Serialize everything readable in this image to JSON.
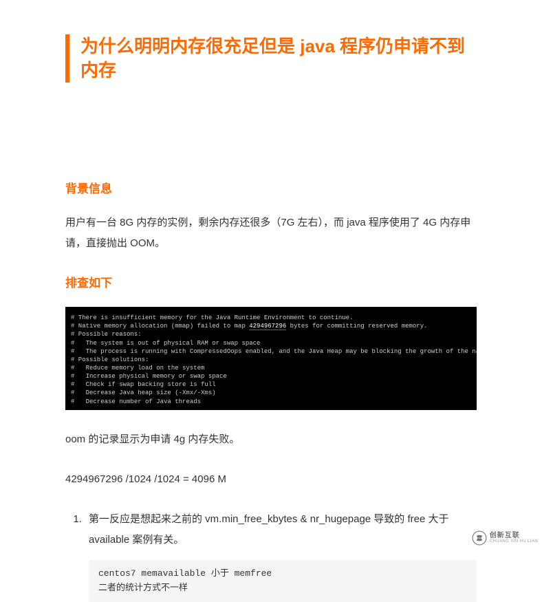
{
  "title": "为什么明明内存很充足但是 java 程序仍申请不到内存",
  "sections": {
    "bg_heading": "背景信息",
    "bg_para": "用户有一台 8G 内存的实例，剩余内存还很多（7G 左右），而 java 程序使用了 4G 内存申请，直接抛出 OOM。",
    "inv_heading": "排查如下",
    "oom_note": "oom 的记录显示为申请 4g 内存失败。",
    "calc_line": "4294967296 /1024 /1024 = 4096 M",
    "step1": "第一反应是想起来之前的 vm.min_free_kbytes & nr_hugepage 导致的 free 大于 available 案例有关。",
    "code_line1": "centos7 memavailable 小于 memfree",
    "code_line2": "二者的统计方式不一样"
  },
  "terminal": {
    "l1a": "# There is insufficient memory for the Java Runtime Environment to continue.",
    "l2a": "# Native memory allocation (mmap) failed to map ",
    "l2b": "4294967296",
    "l2c": " bytes for committing reserved memory.",
    "l3": "# Possible reasons:",
    "l4": "#   The system is out of physical RAM or swap space",
    "l5": "#   The process is running with CompressedOops enabled, and the Java Heap may be blocking the growth of the native heap",
    "l6": "# Possible solutions:",
    "l7": "#   Reduce memory load on the system",
    "l8": "#   Increase physical memory or swap space",
    "l9": "#   Check if swap backing store is full",
    "l10": "#   Decrease Java heap size (-Xmx/-Xms)",
    "l11": "#   Decrease number of Java threads"
  },
  "watermark": {
    "cn": "创新互联",
    "en": "CHUANG XIN HU LIAN"
  }
}
